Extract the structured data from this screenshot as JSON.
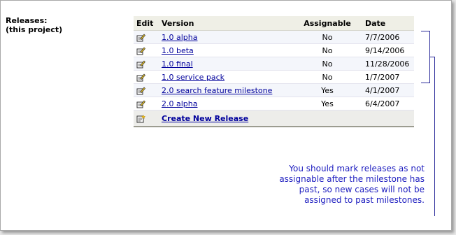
{
  "section": {
    "label_line1": "Releases:",
    "label_line2": "(this project)"
  },
  "table": {
    "headers": {
      "edit": "Edit",
      "version": "Version",
      "assignable": "Assignable",
      "date": "Date"
    },
    "rows": [
      {
        "version": "1.0 alpha",
        "assignable": "No",
        "date": "7/7/2006"
      },
      {
        "version": "1.0 beta",
        "assignable": "No",
        "date": "9/14/2006"
      },
      {
        "version": "1.0 final",
        "assignable": "No",
        "date": "11/28/2006"
      },
      {
        "version": "1.0 service pack",
        "assignable": "No",
        "date": "1/7/2007"
      },
      {
        "version": "2.0 search feature milestone",
        "assignable": "Yes",
        "date": "4/1/2007"
      },
      {
        "version": "2.0 alpha",
        "assignable": "Yes",
        "date": "6/4/2007"
      }
    ],
    "create_label": "Create New Release"
  },
  "annotation": {
    "text": "You should mark releases as not assignable after the milestone has past, so new cases will not be assigned to past milestones."
  },
  "colors": {
    "link": "#00009c",
    "annotation": "#2020c0",
    "header_bg": "#efefe6"
  },
  "icons": {
    "edit": "edit-pencil-icon",
    "create": "new-release-icon"
  }
}
